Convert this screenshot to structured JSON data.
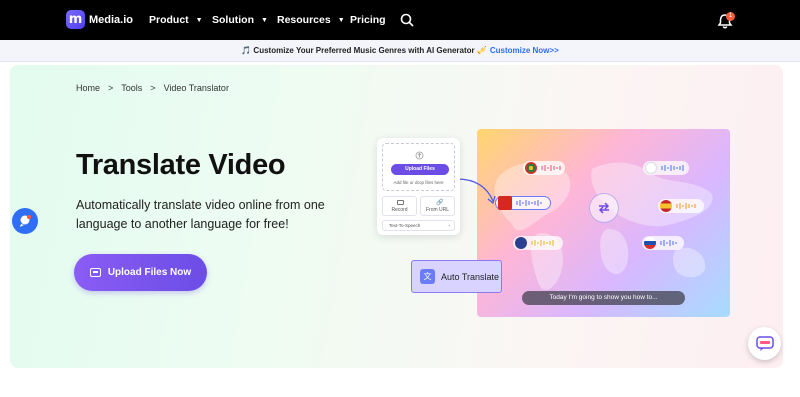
{
  "nav": {
    "brand": "Media.io",
    "logo_letter": "m",
    "items": [
      {
        "label": "Product",
        "has_caret": true
      },
      {
        "label": "Solution",
        "has_caret": true
      },
      {
        "label": "Resources",
        "has_caret": true
      },
      {
        "label": "Pricing",
        "has_caret": false
      }
    ],
    "notification_count": "1"
  },
  "promo": {
    "text": "🎵 Customize Your Preferred Music Genres with AI Generator 🎺",
    "link": "Customize Now>>"
  },
  "breadcrumb": [
    "Home",
    ">",
    "Tools",
    ">",
    "Video Translator"
  ],
  "hero": {
    "title": "Translate Video",
    "description": "Automatically translate video online from one language to another language for free!",
    "cta": "Upload Files Now"
  },
  "illustration": {
    "upload_card": {
      "button": "Upload Files",
      "hint": "Add file or drop files here",
      "record": "Record",
      "from_url": "From URL",
      "tts": "Text-To-Speech"
    },
    "auto_translate": "Auto Translate",
    "subtitle": "Today I'm going to show you how to..."
  },
  "colors": {
    "accent": "#6b4de6",
    "nav_bg": "#000000",
    "link": "#2b6df6"
  },
  "icons": [
    "search-icon",
    "bell-icon",
    "upload-icon",
    "chat-icon",
    "swap-icon",
    "translate-icon"
  ]
}
